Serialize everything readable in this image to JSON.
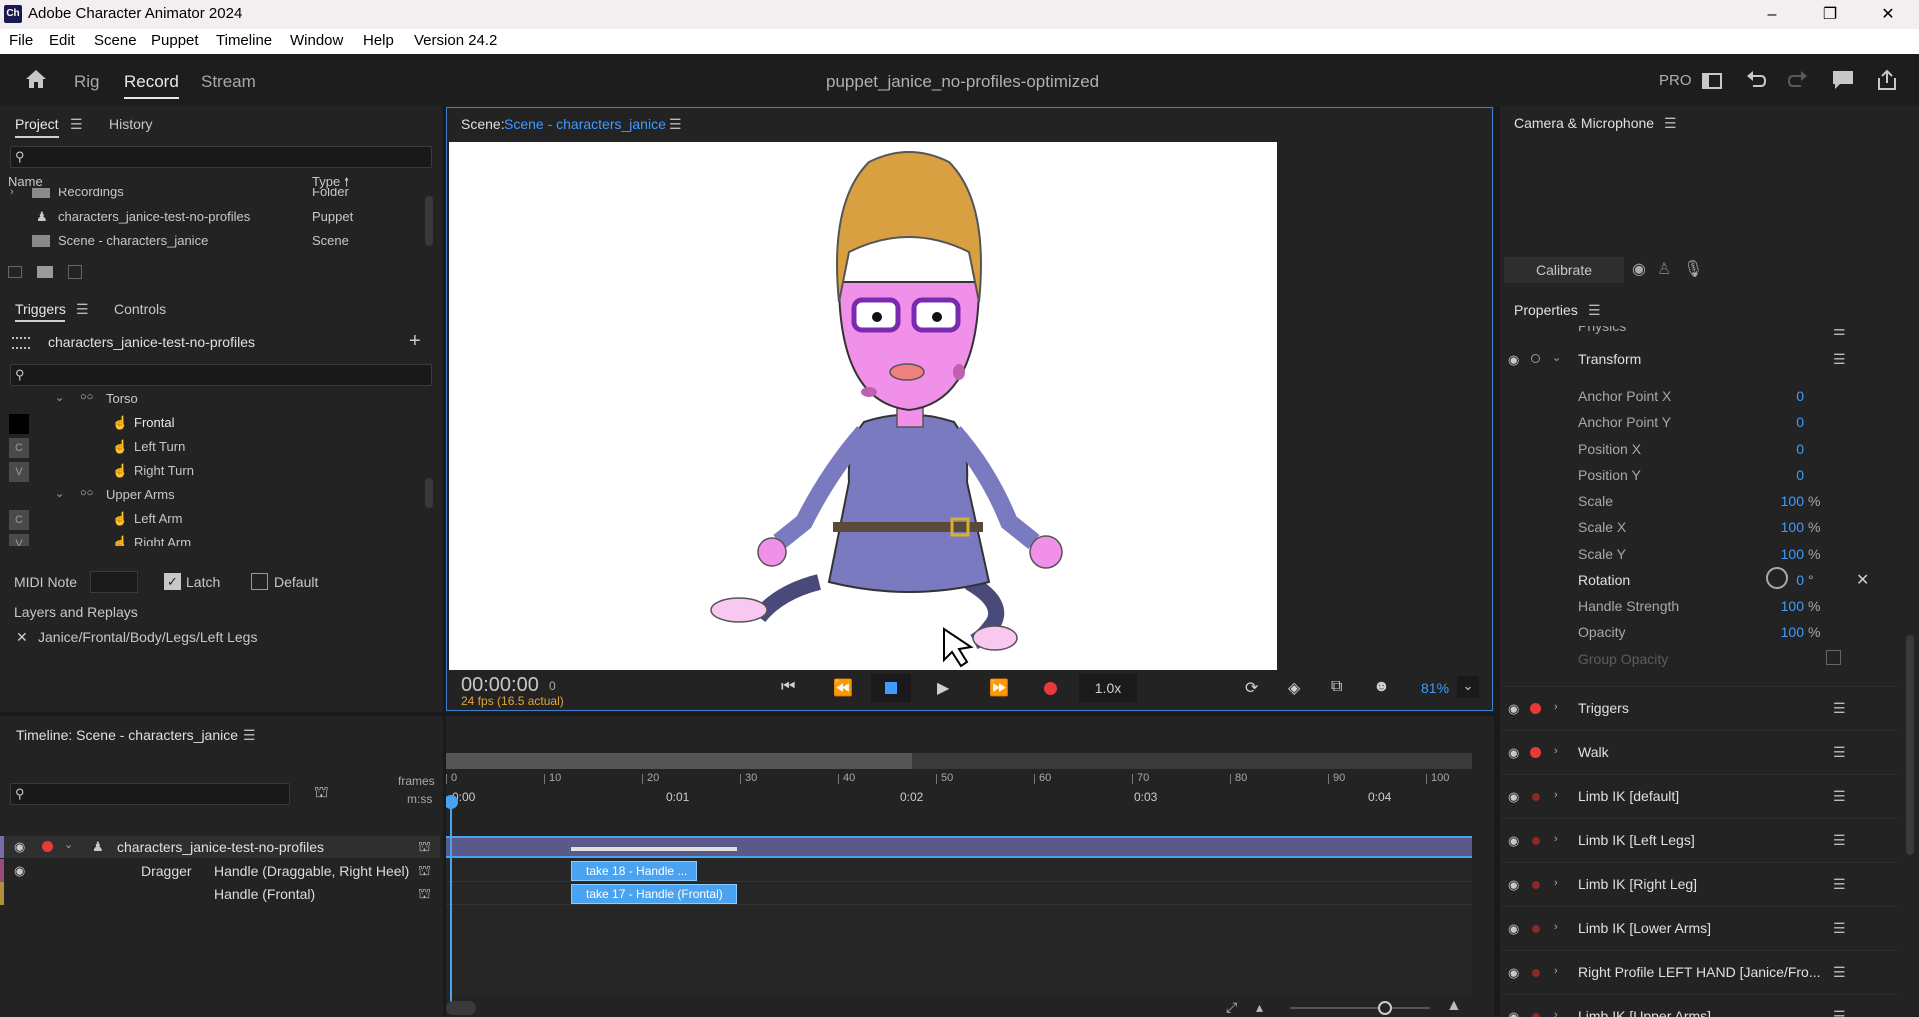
{
  "window": {
    "title": "Adobe Character Animator 2024",
    "logo": "Ch",
    "minimize": "–",
    "restore": "❐",
    "close": "✕"
  },
  "menu": [
    "File",
    "Edit",
    "Scene",
    "Puppet",
    "Timeline",
    "Window",
    "Help",
    "Version 24.2"
  ],
  "workspace": {
    "tabs": [
      "Rig",
      "Record",
      "Stream"
    ],
    "active": "Record",
    "document_title": "puppet_janice_no-profiles-optimized",
    "pro_label": "PRO"
  },
  "project": {
    "tabs": [
      "Project",
      "History"
    ],
    "columns": {
      "name": "Name",
      "type": "Type"
    },
    "items": [
      {
        "name": "Recordings",
        "type": "Folder"
      },
      {
        "name": "characters_janice-test-no-profiles",
        "type": "Puppet"
      },
      {
        "name": "Scene - characters_janice",
        "type": "Scene"
      }
    ]
  },
  "triggers": {
    "tabs": [
      "Triggers",
      "Controls"
    ],
    "puppet": "characters_janice-test-no-profiles",
    "tree": [
      {
        "label": "Torso",
        "key": "",
        "group": true
      },
      {
        "label": "Frontal",
        "key": "",
        "group": false
      },
      {
        "label": "Left Turn",
        "key": "C",
        "group": false
      },
      {
        "label": "Right Turn",
        "key": "V",
        "group": false
      },
      {
        "label": "Upper Arms",
        "key": "",
        "group": true
      },
      {
        "label": "Left Arm",
        "key": "C",
        "group": false
      },
      {
        "label": "Right Arm",
        "key": "V",
        "group": false
      }
    ],
    "midi_label": "MIDI Note",
    "latch_label": "Latch",
    "default_label": "Default",
    "layers_label": "Layers and Replays",
    "layer_path": "Janice/Frontal/Body/Legs/Left Legs"
  },
  "scene": {
    "label": "Scene:",
    "name": "Scene - characters_janice",
    "timecode": "00:00:00",
    "frame": "0",
    "fps": "24 fps (16.5 actual)",
    "speed": "1.0x",
    "zoom": "81%"
  },
  "camera": {
    "title": "Camera & Microphone",
    "calibrate": "Calibrate"
  },
  "properties": {
    "title": "Properties",
    "cut_label": "Physics",
    "transform_label": "Transform",
    "rows": [
      {
        "name": "Anchor Point X",
        "value": "0",
        "unit": ""
      },
      {
        "name": "Anchor Point Y",
        "value": "0",
        "unit": ""
      },
      {
        "name": "Position X",
        "value": "0",
        "unit": ""
      },
      {
        "name": "Position Y",
        "value": "0",
        "unit": ""
      },
      {
        "name": "Scale",
        "value": "100",
        "unit": "%"
      },
      {
        "name": "Scale X",
        "value": "100",
        "unit": "%"
      },
      {
        "name": "Scale Y",
        "value": "100",
        "unit": "%"
      },
      {
        "name": "Rotation",
        "value": "0",
        "unit": "°"
      },
      {
        "name": "Handle Strength",
        "value": "100",
        "unit": "%"
      },
      {
        "name": "Opacity",
        "value": "100",
        "unit": "%"
      }
    ],
    "group_opacity": "Group Opacity",
    "behaviors": [
      "Triggers",
      "Walk",
      "Limb IK [default]",
      "Limb IK [Left Legs]",
      "Limb IK [Right Leg]",
      "Limb IK [Lower Arms]",
      "Right Profile LEFT HAND [Janice/Fro...",
      "Limb IK [Upper Arms]"
    ]
  },
  "timeline": {
    "title": "Timeline: Scene - characters_janice",
    "frames_label": "frames",
    "mss_label": "m:ss",
    "frame_ticks": [
      "0",
      "10",
      "20",
      "30",
      "40",
      "50",
      "60",
      "70",
      "80",
      "90",
      "100"
    ],
    "time_ticks": [
      "0:00",
      "0:01",
      "0:02",
      "0:03",
      "0:04"
    ],
    "track_puppet": "characters_janice-test-no-profiles",
    "track_dragger": "Dragger",
    "track_handle1": "Handle (Draggable, Right Heel)",
    "track_handle2": "Handle (Frontal)",
    "clip1": "take 18 - Handle ...",
    "clip2": "take 17 - Handle (Frontal)"
  },
  "colors": {
    "accent": "#3f9bff",
    "record": "#e63b3b",
    "fps": "#e0a63b"
  }
}
